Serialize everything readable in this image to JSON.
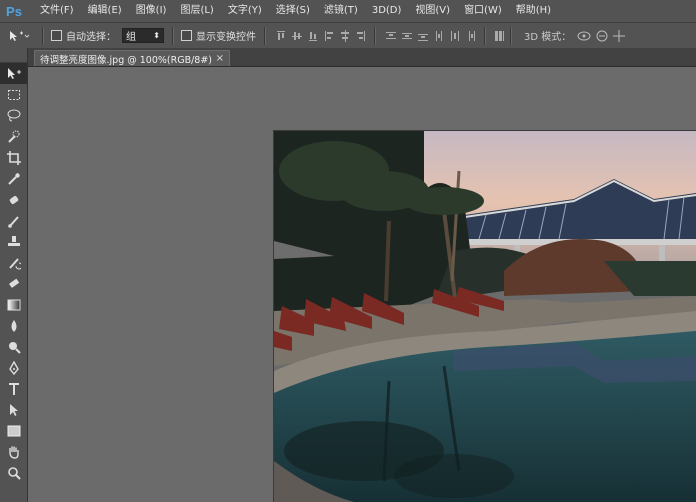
{
  "app": {
    "logo": "Ps"
  },
  "menu": [
    {
      "label": "文件(F)"
    },
    {
      "label": "编辑(E)"
    },
    {
      "label": "图像(I)"
    },
    {
      "label": "图层(L)"
    },
    {
      "label": "文字(Y)"
    },
    {
      "label": "选择(S)"
    },
    {
      "label": "滤镜(T)"
    },
    {
      "label": "3D(D)"
    },
    {
      "label": "视图(V)"
    },
    {
      "label": "窗口(W)"
    },
    {
      "label": "帮助(H)"
    }
  ],
  "options": {
    "auto_select_label": "自动选择：",
    "auto_select_value": "组",
    "show_transform_label": "显示变换控件",
    "mode_label": "3D 模式："
  },
  "document": {
    "tab_title": "待调整亮度图像.jpg @ 100%(RGB/8#)",
    "close": "×"
  },
  "tools": [
    {
      "name": "move-tool-icon"
    },
    {
      "name": "marquee-tool-icon"
    },
    {
      "name": "lasso-tool-icon"
    },
    {
      "name": "quick-selection-tool-icon"
    },
    {
      "name": "crop-tool-icon"
    },
    {
      "name": "eyedropper-tool-icon"
    },
    {
      "name": "healing-brush-tool-icon"
    },
    {
      "name": "brush-tool-icon"
    },
    {
      "name": "clone-stamp-tool-icon"
    },
    {
      "name": "history-brush-tool-icon"
    },
    {
      "name": "eraser-tool-icon"
    },
    {
      "name": "gradient-tool-icon"
    },
    {
      "name": "blur-tool-icon"
    },
    {
      "name": "dodge-tool-icon"
    },
    {
      "name": "pen-tool-icon"
    },
    {
      "name": "type-tool-icon"
    },
    {
      "name": "path-selection-tool-icon"
    },
    {
      "name": "rectangle-tool-icon"
    },
    {
      "name": "hand-tool-icon"
    },
    {
      "name": "zoom-tool-icon"
    }
  ],
  "colors": {
    "chrome": "#535353",
    "workspace": "#6b6b6b",
    "logo": "#4fa3e3"
  }
}
